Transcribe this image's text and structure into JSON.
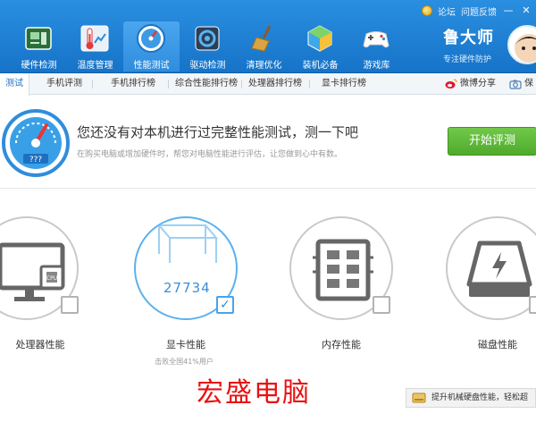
{
  "top_links": {
    "forum": "论坛",
    "feedback": "问题反馈"
  },
  "nav": [
    {
      "label": "硬件检测",
      "icon": "hardware-board-icon"
    },
    {
      "label": "温度管理",
      "icon": "thermometer-icon"
    },
    {
      "label": "性能测试",
      "icon": "speedometer-icon",
      "active": true
    },
    {
      "label": "驱动检测",
      "icon": "driver-chip-icon"
    },
    {
      "label": "清理优化",
      "icon": "broom-icon"
    },
    {
      "label": "装机必备",
      "icon": "cube-icon"
    },
    {
      "label": "游戏库",
      "icon": "gamepad-icon"
    }
  ],
  "brand": {
    "name": "鲁大师",
    "slogan": "专注硬件防护"
  },
  "subtabs": [
    "测试",
    "手机评测",
    "手机排行榜",
    "综合性能排行榜",
    "处理器排行榜",
    "显卡排行榜"
  ],
  "share": {
    "weibo": "微博分享",
    "save": "保"
  },
  "hero": {
    "title": "您还没有对本机进行过完整性能测试，测一下吧",
    "subtitle": "在购买电脑或增加硬件时，帮您对电脑性能进行评估，让您做到心中有数。",
    "gauge_text": "???",
    "start_button": "开始评测"
  },
  "cards": [
    {
      "label": "处理器性能",
      "icon": "cpu-monitor-icon",
      "checked": false
    },
    {
      "label": "显卡性能",
      "icon": "gpu-cube-icon",
      "checked": true,
      "score": "27734",
      "sub": "击败全国41%用户"
    },
    {
      "label": "内存性能",
      "icon": "memory-chip-icon",
      "checked": false
    },
    {
      "label": "磁盘性能",
      "icon": "disk-drive-icon",
      "checked": false
    }
  ],
  "watermark": "宏盛电脑",
  "promo": "提升机械硬盘性能，轻松超",
  "colors": {
    "header": "#1c7bd4",
    "accent": "#2f8ddd",
    "start": "#5bb535",
    "watermark": "#e81111"
  }
}
